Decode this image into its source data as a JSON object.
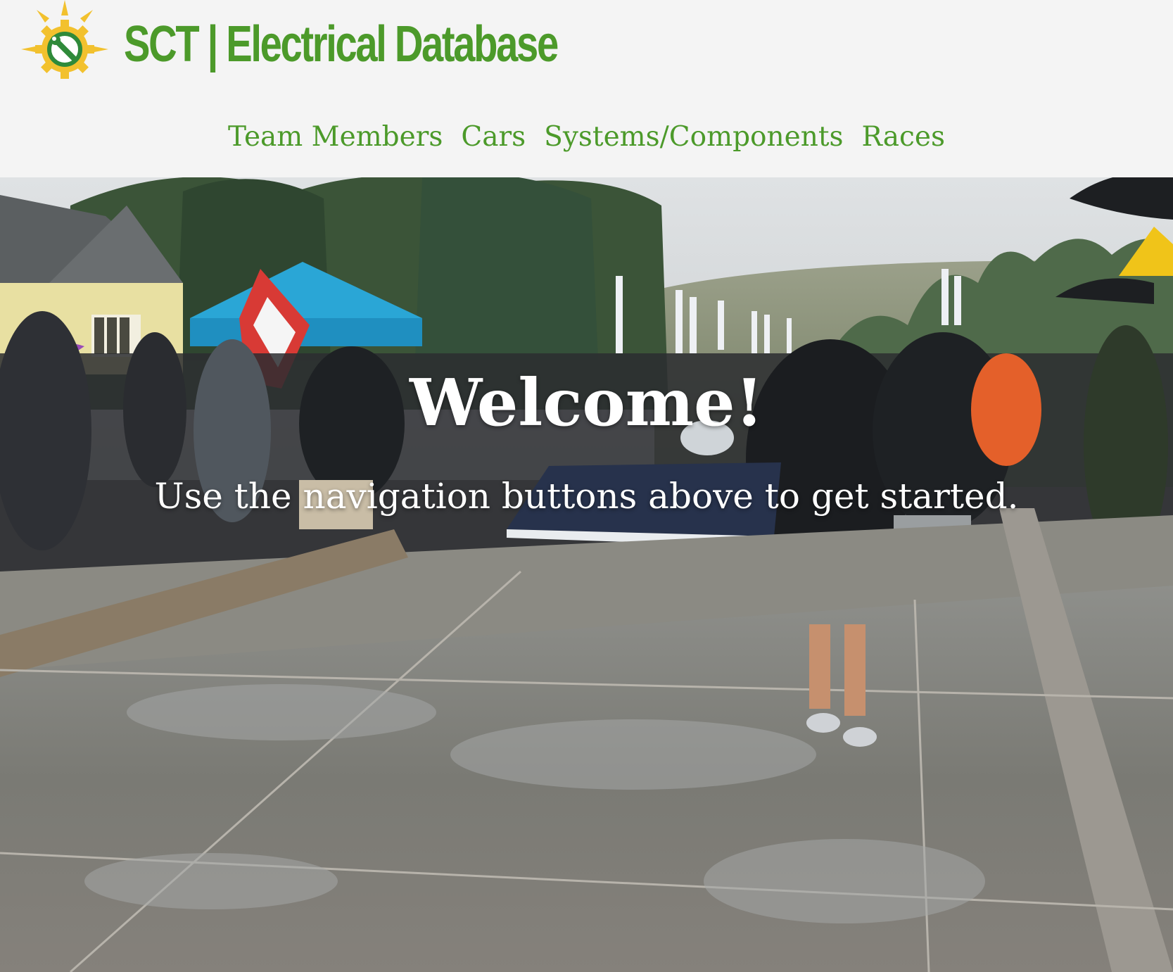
{
  "header": {
    "logo_icon": "sun-gear-wrench-icon",
    "title": "SCT | Electrical Database"
  },
  "nav": {
    "items": [
      {
        "label": "Team Members"
      },
      {
        "label": "Cars"
      },
      {
        "label": "Systems/Components"
      },
      {
        "label": "Races"
      }
    ]
  },
  "hero": {
    "title": "Welcome!",
    "subtitle": "Use the navigation buttons above to get started.",
    "background": "photo-team-walking-solar-car-in-rain"
  },
  "colors": {
    "accent": "#4c9a2a",
    "logo_yellow": "#f2c12e",
    "header_bg": "#f4f4f4",
    "hero_text": "#ffffff"
  }
}
